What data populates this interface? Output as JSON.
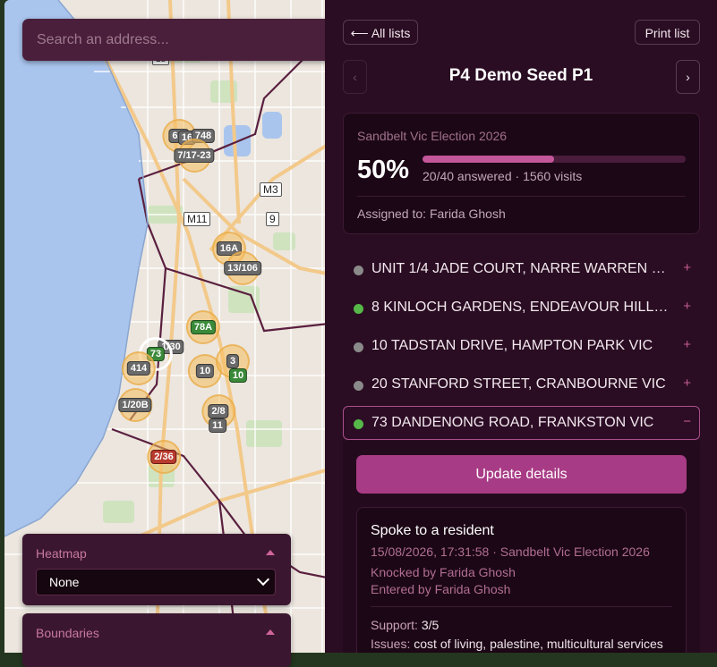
{
  "search": {
    "placeholder": "Search an address..."
  },
  "map": {
    "road_shields": [
      "M3",
      "M11",
      "9",
      "18"
    ],
    "clusters": [
      {
        "label": "6/7",
        "color": "grey"
      },
      {
        "label": "16",
        "color": "grey"
      },
      {
        "label": "748",
        "color": "grey"
      },
      {
        "label": "7/17-23",
        "color": "grey"
      },
      {
        "label": "16A",
        "color": "grey"
      },
      {
        "label": "13/106",
        "color": "grey"
      },
      {
        "label": "78A",
        "color": "green"
      },
      {
        "label": "1/30",
        "color": "grey"
      },
      {
        "label": "73",
        "color": "green"
      },
      {
        "label": "414",
        "color": "grey"
      },
      {
        "label": "10",
        "color": "grey"
      },
      {
        "label": "3",
        "color": "grey"
      },
      {
        "label": "10",
        "color": "green"
      },
      {
        "label": "1/20B",
        "color": "grey"
      },
      {
        "label": "2/8",
        "color": "grey"
      },
      {
        "label": "11",
        "color": "grey"
      },
      {
        "label": "2/36",
        "color": "red"
      }
    ]
  },
  "heatmap": {
    "title": "Heatmap",
    "value": "None"
  },
  "boundaries": {
    "title": "Boundaries"
  },
  "sidebar": {
    "all_lists": "⟵ All lists",
    "print_list": "Print list",
    "prev": "‹",
    "next": "›",
    "list_title": "P4 Demo Seed P1",
    "election": "Sandbelt Vic Election 2026",
    "percent": "50%",
    "progress": 0.5,
    "stats": "20/40 answered · 1560 visits",
    "assigned": "Assigned to: Farida Ghosh",
    "addresses": [
      {
        "text": "UNIT 1/4 JADE COURT, NARRE WARREN SOUTH VIC",
        "status": "grey",
        "sign": "+"
      },
      {
        "text": "8 KINLOCH GARDENS, ENDEAVOUR HILLS VIC",
        "status": "green",
        "sign": "+"
      },
      {
        "text": "10 TADSTAN DRIVE, HAMPTON PARK VIC",
        "status": "grey",
        "sign": "+"
      },
      {
        "text": "20 STANFORD STREET, CRANBOURNE VIC",
        "status": "grey",
        "sign": "+"
      },
      {
        "text": "73 DANDENONG ROAD, FRANKSTON VIC",
        "status": "green",
        "sign": "−"
      }
    ],
    "update_button": "Update details",
    "visit": {
      "heading": "Spoke to a resident",
      "meta": "15/08/2026, 17:31:58 · Sandbelt Vic Election 2026",
      "knocked": "Knocked by Farida Ghosh",
      "entered": "Entered by Farida Ghosh",
      "support_label": "Support:",
      "support_value": "3/5",
      "issues_label": "Issues:",
      "issues_value": "cost of living, palestine, multicultural services"
    }
  }
}
